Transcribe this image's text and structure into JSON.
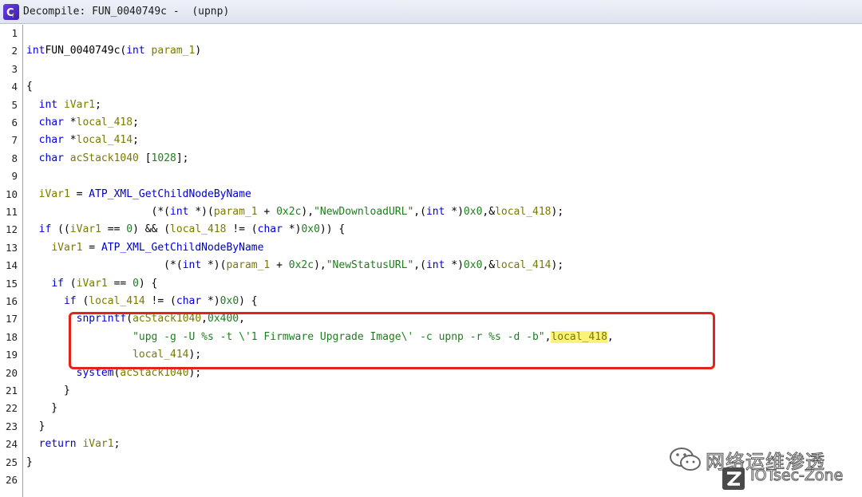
{
  "window": {
    "icon": "decompiler-icon",
    "title": "Decompile: FUN_0040749c -  (upnp)"
  },
  "code_lines": [
    {
      "n": "1",
      "tokens": []
    },
    {
      "n": "2",
      "tokens": [
        [
          "kw",
          "int"
        ],
        [
          "",
          "FUN_0040749c("
        ],
        [
          "kw",
          "int"
        ],
        [
          "var",
          " param_1"
        ],
        [
          "",
          ")"
        ]
      ]
    },
    {
      "n": "3",
      "tokens": []
    },
    {
      "n": "4",
      "tokens": [
        [
          "",
          "{"
        ]
      ]
    },
    {
      "n": "5",
      "tokens": [
        [
          "",
          "  "
        ],
        [
          "kw",
          "int"
        ],
        [
          "var",
          " iVar1"
        ],
        [
          "",
          ";"
        ]
      ]
    },
    {
      "n": "6",
      "tokens": [
        [
          "",
          "  "
        ],
        [
          "kw",
          "char"
        ],
        [
          "",
          " *"
        ],
        [
          "var",
          "local_418"
        ],
        [
          "",
          ";"
        ]
      ]
    },
    {
      "n": "7",
      "tokens": [
        [
          "",
          "  "
        ],
        [
          "kw",
          "char"
        ],
        [
          "",
          " *"
        ],
        [
          "var",
          "local_414"
        ],
        [
          "",
          ";"
        ]
      ]
    },
    {
      "n": "8",
      "tokens": [
        [
          "",
          "  "
        ],
        [
          "kw",
          "char"
        ],
        [
          "var",
          " acStack1040"
        ],
        [
          "",
          " ["
        ],
        [
          "num",
          "1028"
        ],
        [
          "",
          "];"
        ]
      ]
    },
    {
      "n": "9",
      "tokens": []
    },
    {
      "n": "10",
      "tokens": [
        [
          "",
          "  "
        ],
        [
          "var",
          "iVar1"
        ],
        [
          "",
          " = "
        ],
        [
          "fn",
          "ATP_XML_GetChildNodeByName"
        ]
      ]
    },
    {
      "n": "11",
      "tokens": [
        [
          "",
          "                    (*("
        ],
        [
          "kw",
          "int"
        ],
        [
          "",
          " *)("
        ],
        [
          "var",
          "param_1"
        ],
        [
          "",
          " + "
        ],
        [
          "num",
          "0x2c"
        ],
        [
          "",
          "),"
        ],
        [
          "str",
          "\"NewDownloadURL\""
        ],
        [
          "",
          ",("
        ],
        [
          "kw",
          "int"
        ],
        [
          "",
          " *)"
        ],
        [
          "num",
          "0x0"
        ],
        [
          "",
          ",&"
        ],
        [
          "var",
          "local_418"
        ],
        [
          "",
          ");"
        ]
      ]
    },
    {
      "n": "12",
      "tokens": [
        [
          "",
          "  "
        ],
        [
          "kw",
          "if"
        ],
        [
          "",
          " (("
        ],
        [
          "var",
          "iVar1"
        ],
        [
          "",
          " == "
        ],
        [
          "num",
          "0"
        ],
        [
          "",
          ") && ("
        ],
        [
          "var",
          "local_418"
        ],
        [
          "",
          " != ("
        ],
        [
          "kw",
          "char"
        ],
        [
          "",
          " *)"
        ],
        [
          "num",
          "0x0"
        ],
        [
          "",
          ")) {"
        ]
      ]
    },
    {
      "n": "13",
      "tokens": [
        [
          "",
          "    "
        ],
        [
          "var",
          "iVar1"
        ],
        [
          "",
          " = "
        ],
        [
          "fn",
          "ATP_XML_GetChildNodeByName"
        ]
      ]
    },
    {
      "n": "14",
      "tokens": [
        [
          "",
          "                      (*("
        ],
        [
          "kw",
          "int"
        ],
        [
          "",
          " *)("
        ],
        [
          "var",
          "param_1"
        ],
        [
          "",
          " + "
        ],
        [
          "num",
          "0x2c"
        ],
        [
          "",
          "),"
        ],
        [
          "str",
          "\"NewStatusURL\""
        ],
        [
          "",
          ",("
        ],
        [
          "kw",
          "int"
        ],
        [
          "",
          " *)"
        ],
        [
          "num",
          "0x0"
        ],
        [
          "",
          ",&"
        ],
        [
          "var",
          "local_414"
        ],
        [
          "",
          ");"
        ]
      ]
    },
    {
      "n": "15",
      "tokens": [
        [
          "",
          "    "
        ],
        [
          "kw",
          "if"
        ],
        [
          "",
          " ("
        ],
        [
          "var",
          "iVar1"
        ],
        [
          "",
          " == "
        ],
        [
          "num",
          "0"
        ],
        [
          "",
          ") {"
        ]
      ]
    },
    {
      "n": "16",
      "tokens": [
        [
          "",
          "      "
        ],
        [
          "kw",
          "if"
        ],
        [
          "",
          " ("
        ],
        [
          "var",
          "local_414"
        ],
        [
          "",
          " != ("
        ],
        [
          "kw",
          "char"
        ],
        [
          "",
          " *)"
        ],
        [
          "num",
          "0x0"
        ],
        [
          "",
          ") {"
        ]
      ]
    },
    {
      "n": "17",
      "tokens": [
        [
          "",
          "        "
        ],
        [
          "fn",
          "snprintf"
        ],
        [
          "",
          "("
        ],
        [
          "var",
          "acStack1040"
        ],
        [
          "",
          ","
        ],
        [
          "num",
          "0x400"
        ],
        [
          "",
          ","
        ]
      ]
    },
    {
      "n": "18",
      "tokens": [
        [
          "",
          "                 "
        ],
        [
          "str",
          "\"upg -g -U %s -t \\'1 Firmware Upgrade Image\\' -c upnp -r %s -d -b\""
        ],
        [
          "",
          ","
        ],
        [
          "hl",
          "local_418"
        ],
        [
          "",
          ","
        ]
      ]
    },
    {
      "n": "19",
      "tokens": [
        [
          "",
          "                 "
        ],
        [
          "var",
          "local_414"
        ],
        [
          "",
          ");"
        ]
      ]
    },
    {
      "n": "20",
      "tokens": [
        [
          "",
          "        "
        ],
        [
          "fn",
          "system"
        ],
        [
          "",
          "("
        ],
        [
          "var",
          "acStack1040"
        ],
        [
          "",
          ");"
        ]
      ]
    },
    {
      "n": "21",
      "tokens": [
        [
          "",
          "      }"
        ]
      ]
    },
    {
      "n": "22",
      "tokens": [
        [
          "",
          "    }"
        ]
      ]
    },
    {
      "n": "23",
      "tokens": [
        [
          "",
          "  }"
        ]
      ]
    },
    {
      "n": "24",
      "tokens": [
        [
          "",
          "  "
        ],
        [
          "kw",
          "return"
        ],
        [
          "var",
          " iVar1"
        ],
        [
          "",
          ";"
        ]
      ]
    },
    {
      "n": "25",
      "tokens": [
        [
          "",
          "}"
        ]
      ]
    },
    {
      "n": "26",
      "tokens": []
    }
  ],
  "watermark": {
    "chinese": "网络运维渗透",
    "english": "IOTsec-Zone",
    "icons": [
      "wechat-icon",
      "z-logo-icon"
    ]
  },
  "colors": {
    "keyword": "#0000d8",
    "variable": "#7a7a00",
    "string": "#1e7e1e",
    "highlight_box": "#e2231a",
    "selection": "#fbf27a"
  }
}
